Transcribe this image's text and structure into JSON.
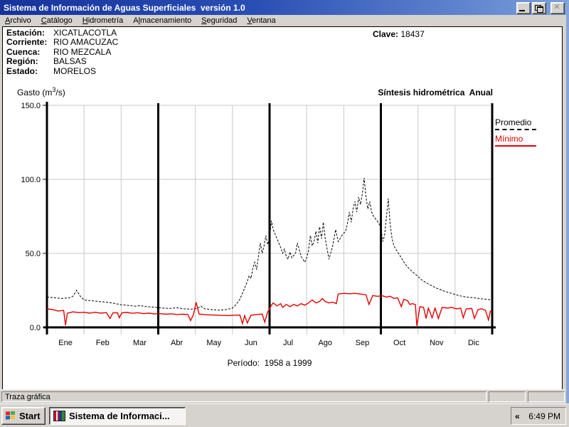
{
  "window": {
    "title": "Sistema de Información de Aguas Superficiales  versión 1.0"
  },
  "menu": {
    "items": [
      {
        "label": "Archivo",
        "u": 0
      },
      {
        "label": "Catálogo",
        "u": 0
      },
      {
        "label": "Hidrometría",
        "u": 0
      },
      {
        "label": "Almacenamiento",
        "u": 1
      },
      {
        "label": "Seguridad",
        "u": 0
      },
      {
        "label": "Ventana",
        "u": 0
      }
    ]
  },
  "station": {
    "rows": [
      {
        "label": "Estación:",
        "value": "XICATLACOTLA"
      },
      {
        "label": "Corriente:",
        "value": "RIO AMACUZAC"
      },
      {
        "label": "Cuenca:",
        "value": "RIO MEZCALA"
      },
      {
        "label": "Región:",
        "value": "BALSAS"
      },
      {
        "label": "Estado:",
        "value": "MORELOS"
      }
    ],
    "clave_label": "Clave:",
    "clave_value": "18437"
  },
  "chart_header": {
    "gasto_prefix": "Gasto (m",
    "gasto_sup": "3",
    "gasto_suffix": "/s)",
    "title_right": "Síntesis hidrométrica  Anual"
  },
  "chart_data": {
    "type": "line",
    "title": "Síntesis hidrométrica Anual",
    "ylabel": "Gasto (m³/s)",
    "xlabel": "",
    "ylim": [
      0,
      150
    ],
    "yticks": [
      0,
      50,
      100,
      150
    ],
    "ytick_labels": [
      "0.0",
      "50.0",
      "100.0",
      "150.0"
    ],
    "x_labels": [
      "Ene",
      "Feb",
      "Mar",
      "Abr",
      "May",
      "Jun",
      "Jul",
      "Ago",
      "Sep",
      "Oct",
      "Nov",
      "Dic"
    ],
    "grid": true,
    "quarter_dividers_months": [
      3,
      6,
      9
    ],
    "legend_position": "right-outside",
    "period_note": "Período:  1958 a 1999",
    "x_units": "months (0-12, daily resolution)",
    "series": [
      {
        "name": "Promedio",
        "color": "#000000",
        "style": "dashed",
        "points": [
          [
            0,
            20.5
          ],
          [
            0.2,
            20
          ],
          [
            0.4,
            19.5
          ],
          [
            0.6,
            20
          ],
          [
            0.7,
            21
          ],
          [
            0.8,
            25
          ],
          [
            0.9,
            21
          ],
          [
            1,
            18.5
          ],
          [
            1.2,
            18
          ],
          [
            1.4,
            17.5
          ],
          [
            1.6,
            17
          ],
          [
            1.8,
            16.3
          ],
          [
            2,
            15.3
          ],
          [
            2.2,
            14.8
          ],
          [
            2.4,
            14.3
          ],
          [
            2.5,
            14.7
          ],
          [
            2.7,
            14
          ],
          [
            2.9,
            13.6
          ],
          [
            3.1,
            13.1
          ],
          [
            3.3,
            12.8
          ],
          [
            3.5,
            13.2
          ],
          [
            3.7,
            12.5
          ],
          [
            3.9,
            12.3
          ],
          [
            4.05,
            12.8
          ],
          [
            4.15,
            14.3
          ],
          [
            4.25,
            12.6
          ],
          [
            4.45,
            11.9
          ],
          [
            4.65,
            11.6
          ],
          [
            4.85,
            12.1
          ],
          [
            5,
            13
          ],
          [
            5.1,
            15.5
          ],
          [
            5.2,
            19
          ],
          [
            5.3,
            25
          ],
          [
            5.4,
            31
          ],
          [
            5.45,
            35
          ],
          [
            5.5,
            33
          ],
          [
            5.55,
            40
          ],
          [
            5.6,
            44
          ],
          [
            5.65,
            39
          ],
          [
            5.7,
            48
          ],
          [
            5.75,
            57
          ],
          [
            5.8,
            50
          ],
          [
            5.85,
            55
          ],
          [
            5.9,
            62
          ],
          [
            5.95,
            56
          ],
          [
            6,
            60
          ],
          [
            6.05,
            72
          ],
          [
            6.1,
            66
          ],
          [
            6.2,
            60
          ],
          [
            6.3,
            54
          ],
          [
            6.35,
            50
          ],
          [
            6.4,
            53
          ],
          [
            6.45,
            48
          ],
          [
            6.5,
            46
          ],
          [
            6.55,
            51
          ],
          [
            6.6,
            47
          ],
          [
            6.7,
            50
          ],
          [
            6.75,
            57
          ],
          [
            6.85,
            48
          ],
          [
            6.95,
            44
          ],
          [
            7,
            47
          ],
          [
            7.05,
            52
          ],
          [
            7.1,
            62
          ],
          [
            7.15,
            55
          ],
          [
            7.2,
            58
          ],
          [
            7.25,
            65
          ],
          [
            7.3,
            57
          ],
          [
            7.35,
            68
          ],
          [
            7.4,
            60
          ],
          [
            7.45,
            71
          ],
          [
            7.5,
            60
          ],
          [
            7.55,
            53
          ],
          [
            7.6,
            46
          ],
          [
            7.7,
            55
          ],
          [
            7.78,
            66
          ],
          [
            7.85,
            58
          ],
          [
            7.95,
            62
          ],
          [
            8.05,
            65
          ],
          [
            8.1,
            70
          ],
          [
            8.15,
            78
          ],
          [
            8.2,
            71
          ],
          [
            8.25,
            80
          ],
          [
            8.3,
            85
          ],
          [
            8.35,
            78
          ],
          [
            8.4,
            88
          ],
          [
            8.45,
            83
          ],
          [
            8.5,
            90
          ],
          [
            8.55,
            101
          ],
          [
            8.6,
            88
          ],
          [
            8.65,
            80
          ],
          [
            8.7,
            85
          ],
          [
            8.75,
            78
          ],
          [
            8.8,
            75
          ],
          [
            8.9,
            72
          ],
          [
            9,
            68
          ],
          [
            9.05,
            58
          ],
          [
            9.1,
            62
          ],
          [
            9.2,
            87
          ],
          [
            9.25,
            70
          ],
          [
            9.3,
            60
          ],
          [
            9.35,
            55
          ],
          [
            9.45,
            51
          ],
          [
            9.55,
            47
          ],
          [
            9.65,
            43
          ],
          [
            9.75,
            40
          ],
          [
            9.85,
            37.5
          ],
          [
            9.95,
            35.5
          ],
          [
            10.1,
            32
          ],
          [
            10.3,
            29
          ],
          [
            10.5,
            26.5
          ],
          [
            10.7,
            24.5
          ],
          [
            10.9,
            23
          ],
          [
            11.1,
            21.5
          ],
          [
            11.3,
            20.5
          ],
          [
            11.5,
            20
          ],
          [
            11.7,
            19.3
          ],
          [
            11.85,
            19
          ],
          [
            12,
            18.5
          ]
        ]
      },
      {
        "name": "Mínimo",
        "color": "#e60000",
        "style": "solid",
        "points": [
          [
            0,
            12.5
          ],
          [
            0.15,
            12
          ],
          [
            0.3,
            11
          ],
          [
            0.45,
            11.5
          ],
          [
            0.5,
            1.5
          ],
          [
            0.55,
            9.5
          ],
          [
            0.7,
            10.5
          ],
          [
            0.85,
            10
          ],
          [
            1,
            10.2
          ],
          [
            1.15,
            9.6
          ],
          [
            1.3,
            10.2
          ],
          [
            1.45,
            9.6
          ],
          [
            1.6,
            10
          ],
          [
            1.7,
            6
          ],
          [
            1.78,
            9.8
          ],
          [
            1.9,
            9.9
          ],
          [
            1.95,
            6.5
          ],
          [
            2.02,
            9.8
          ],
          [
            2.15,
            10.1
          ],
          [
            2.3,
            9.5
          ],
          [
            2.45,
            9.9
          ],
          [
            2.6,
            9.3
          ],
          [
            2.75,
            9.6
          ],
          [
            2.9,
            9.1
          ],
          [
            3.05,
            9.3
          ],
          [
            3.2,
            8.9
          ],
          [
            3.35,
            9.2
          ],
          [
            3.5,
            8.7
          ],
          [
            3.65,
            8.9
          ],
          [
            3.8,
            8.7
          ],
          [
            3.87,
            4.5
          ],
          [
            3.95,
            8.8
          ],
          [
            4.02,
            17
          ],
          [
            4.1,
            9
          ],
          [
            4.3,
            8.5
          ],
          [
            4.5,
            8.3
          ],
          [
            4.7,
            8.1
          ],
          [
            4.9,
            8
          ],
          [
            5.05,
            8.2
          ],
          [
            5.2,
            8.3
          ],
          [
            5.27,
            2.5
          ],
          [
            5.33,
            8
          ],
          [
            5.4,
            3
          ],
          [
            5.5,
            8.2
          ],
          [
            5.65,
            8.6
          ],
          [
            5.8,
            9
          ],
          [
            5.87,
            3.5
          ],
          [
            5.95,
            10.5
          ],
          [
            6,
            12.5
          ],
          [
            6.05,
            15
          ],
          [
            6.1,
            16.5
          ],
          [
            6.2,
            14.5
          ],
          [
            6.3,
            16
          ],
          [
            6.35,
            13.5
          ],
          [
            6.45,
            15.5
          ],
          [
            6.55,
            14
          ],
          [
            6.65,
            15.5
          ],
          [
            6.75,
            14.5
          ],
          [
            6.85,
            16
          ],
          [
            6.95,
            15
          ],
          [
            7.05,
            16.5
          ],
          [
            7.15,
            18.5
          ],
          [
            7.25,
            16.5
          ],
          [
            7.35,
            17.5
          ],
          [
            7.42,
            19.5
          ],
          [
            7.5,
            17.5
          ],
          [
            7.6,
            16.5
          ],
          [
            7.7,
            17
          ],
          [
            7.8,
            16
          ],
          [
            7.85,
            22.5
          ],
          [
            8,
            23
          ],
          [
            8.15,
            22.7
          ],
          [
            8.3,
            23
          ],
          [
            8.45,
            22.5
          ],
          [
            8.6,
            22
          ],
          [
            8.68,
            15.5
          ],
          [
            8.78,
            21.5
          ],
          [
            8.9,
            21
          ],
          [
            9.05,
            21.3
          ],
          [
            9.15,
            20.5
          ],
          [
            9.25,
            21
          ],
          [
            9.35,
            19.5
          ],
          [
            9.45,
            20
          ],
          [
            9.55,
            14
          ],
          [
            9.62,
            19
          ],
          [
            9.72,
            18
          ],
          [
            9.78,
            15.5
          ],
          [
            9.85,
            16
          ],
          [
            9.93,
            15.5
          ],
          [
            9.97,
            1
          ],
          [
            10.05,
            14
          ],
          [
            10.15,
            13.5
          ],
          [
            10.22,
            6
          ],
          [
            10.28,
            13
          ],
          [
            10.38,
            6.5
          ],
          [
            10.46,
            13
          ],
          [
            10.55,
            6
          ],
          [
            10.65,
            13.5
          ],
          [
            10.8,
            13
          ],
          [
            10.9,
            13.5
          ],
          [
            11.05,
            12.5
          ],
          [
            11.15,
            13
          ],
          [
            11.22,
            6.5
          ],
          [
            11.3,
            12.5
          ],
          [
            11.45,
            12.8
          ],
          [
            11.52,
            6
          ],
          [
            11.62,
            12
          ],
          [
            11.72,
            12.5
          ],
          [
            11.82,
            11.5
          ],
          [
            11.9,
            5
          ],
          [
            11.95,
            11
          ],
          [
            12,
            10.5
          ]
        ]
      }
    ]
  },
  "status_bar": {
    "text": "Traza gráfica"
  },
  "taskbar": {
    "start_label": "Start",
    "task_label": "Sistema de Informaci...",
    "tray_chevron": "«",
    "clock": "6:49 PM"
  },
  "colors": {
    "titlebar_left": "#16339c",
    "titlebar_right": "#7ba0dc",
    "chrome": "#d6d3ce",
    "grid": "#c8c8c8",
    "promedio": "#000000",
    "minimo": "#e60000"
  }
}
